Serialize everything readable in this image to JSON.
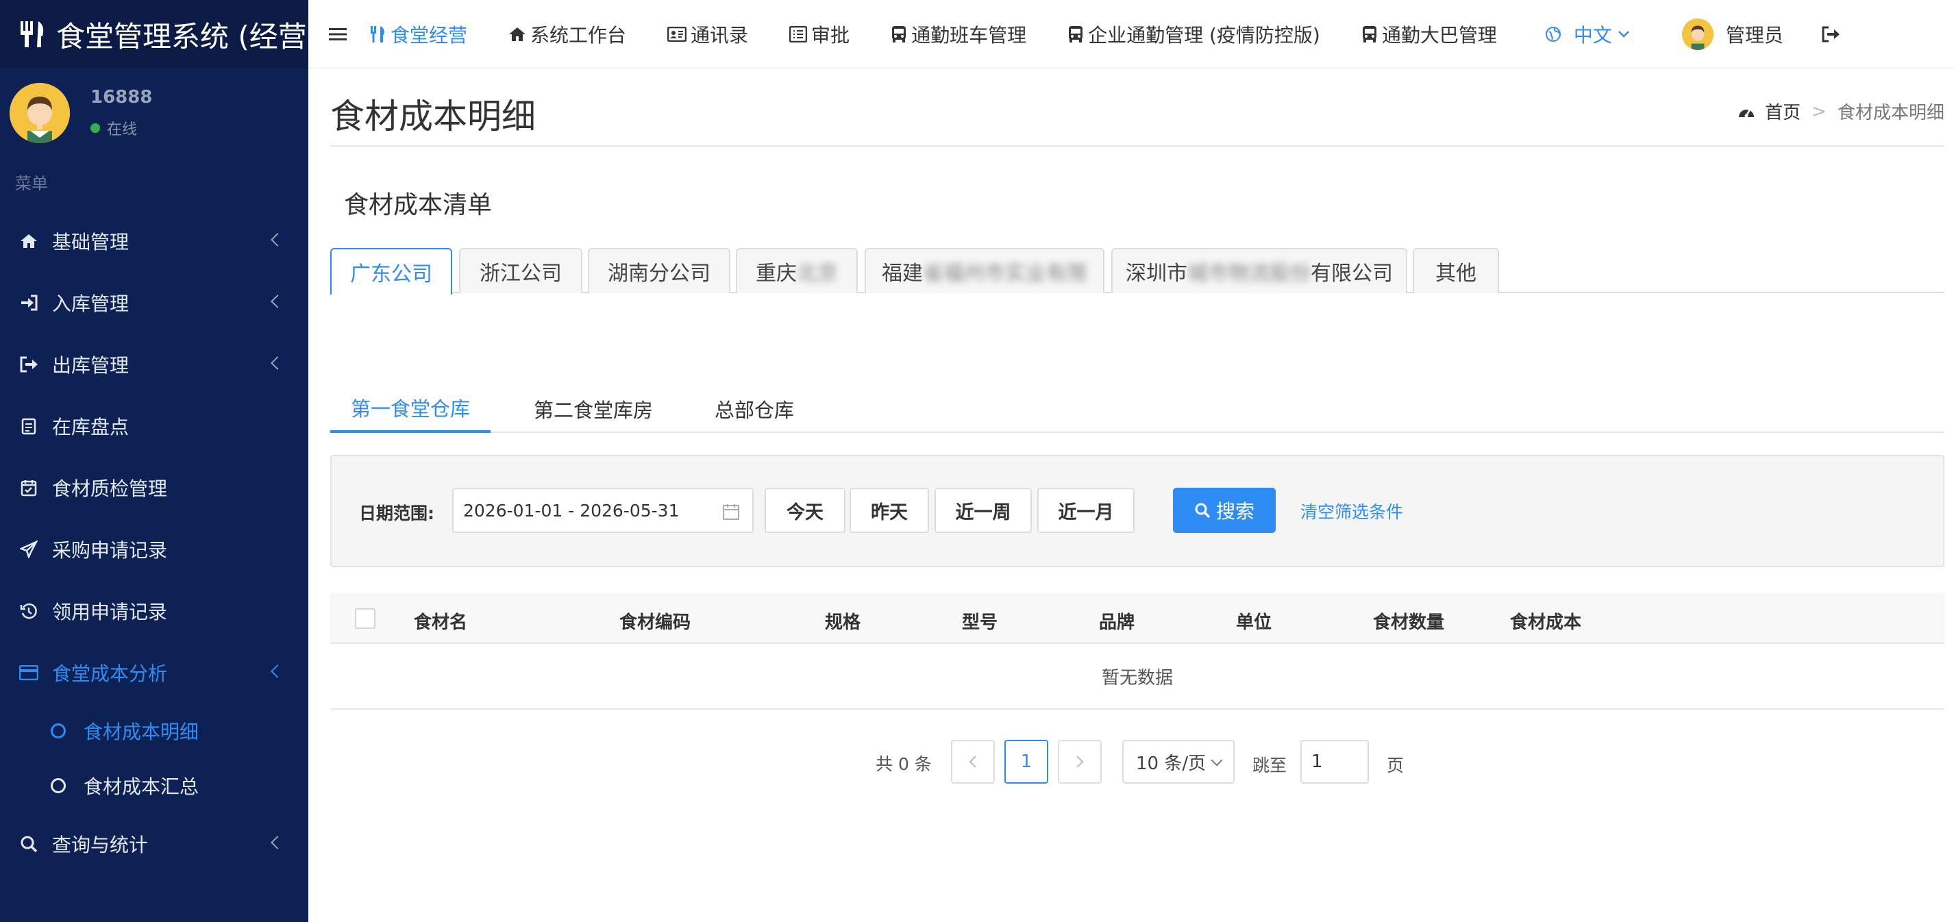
{
  "app": {
    "title": "食堂管理系统 (经营"
  },
  "user": {
    "name": "16888",
    "status": "在线"
  },
  "sidebar": {
    "menu_header": "菜单",
    "items": [
      {
        "label": "基础管理",
        "icon": "home-icon"
      },
      {
        "label": "入库管理",
        "icon": "sign-in-icon"
      },
      {
        "label": "出库管理",
        "icon": "sign-out-icon"
      },
      {
        "label": "在库盘点",
        "icon": "clipboard-icon"
      },
      {
        "label": "食材质检管理",
        "icon": "calendar-check-icon"
      },
      {
        "label": "采购申请记录",
        "icon": "send-icon"
      },
      {
        "label": "领用申请记录",
        "icon": "history-icon"
      },
      {
        "label": "食堂成本分析",
        "icon": "credit-card-icon",
        "active": true
      },
      {
        "label": "查询与统计",
        "icon": "search-icon"
      }
    ],
    "subitems": [
      {
        "label": "食材成本明细",
        "active": true
      },
      {
        "label": "食材成本汇总"
      }
    ]
  },
  "topnav": {
    "items": [
      {
        "label": "食堂经营",
        "icon": "cutlery-icon",
        "active": true
      },
      {
        "label": "系统工作台",
        "icon": "home-icon"
      },
      {
        "label": "通讯录",
        "icon": "address-card-icon"
      },
      {
        "label": "审批",
        "icon": "list-alt-icon"
      },
      {
        "label": "通勤班车管理",
        "icon": "bus-icon"
      },
      {
        "label": "企业通勤管理 (疫情防控版)",
        "icon": "bus-icon"
      },
      {
        "label": "通勤大巴管理",
        "icon": "bus-icon"
      }
    ],
    "language": "中文",
    "admin": "管理员"
  },
  "page": {
    "title": "食材成本明细",
    "breadcrumb": {
      "home": "首页",
      "current": "食材成本明细"
    },
    "section_title": "食材成本清单"
  },
  "company_tabs": [
    {
      "label": "广东公司",
      "active": true
    },
    {
      "label": "浙江公司"
    },
    {
      "label": "湖南分公司"
    },
    {
      "label": "重庆",
      "blurred": "北京"
    },
    {
      "label": "福建",
      "blurred": "省福州市实业有限"
    },
    {
      "label": "深圳市",
      "blurred": "城市物流股份",
      "suffix": "有限公司"
    },
    {
      "label": "其他"
    }
  ],
  "warehouse_tabs": [
    {
      "label": "第一食堂仓库",
      "active": true
    },
    {
      "label": "第二食堂库房"
    },
    {
      "label": "总部仓库"
    }
  ],
  "filter": {
    "date_label": "日期范围:",
    "date_value": "2026-01-01 - 2026-05-31",
    "quick": [
      "今天",
      "昨天",
      "近一周",
      "近一月"
    ],
    "search": "搜索",
    "clear": "清空筛选条件"
  },
  "table": {
    "columns": [
      "食材名",
      "食材编码",
      "规格",
      "型号",
      "品牌",
      "单位",
      "食材数量",
      "食材成本"
    ],
    "rows": [],
    "empty_text": "暂无数据"
  },
  "pagination": {
    "total_text": "共 0 条",
    "current_page": "1",
    "page_size": "10 条/页",
    "jump_label": "跳至",
    "jump_value": "1",
    "page_suffix": "页"
  },
  "colors": {
    "accent": "#2f8cf3",
    "sidebar": "#0e2155"
  }
}
